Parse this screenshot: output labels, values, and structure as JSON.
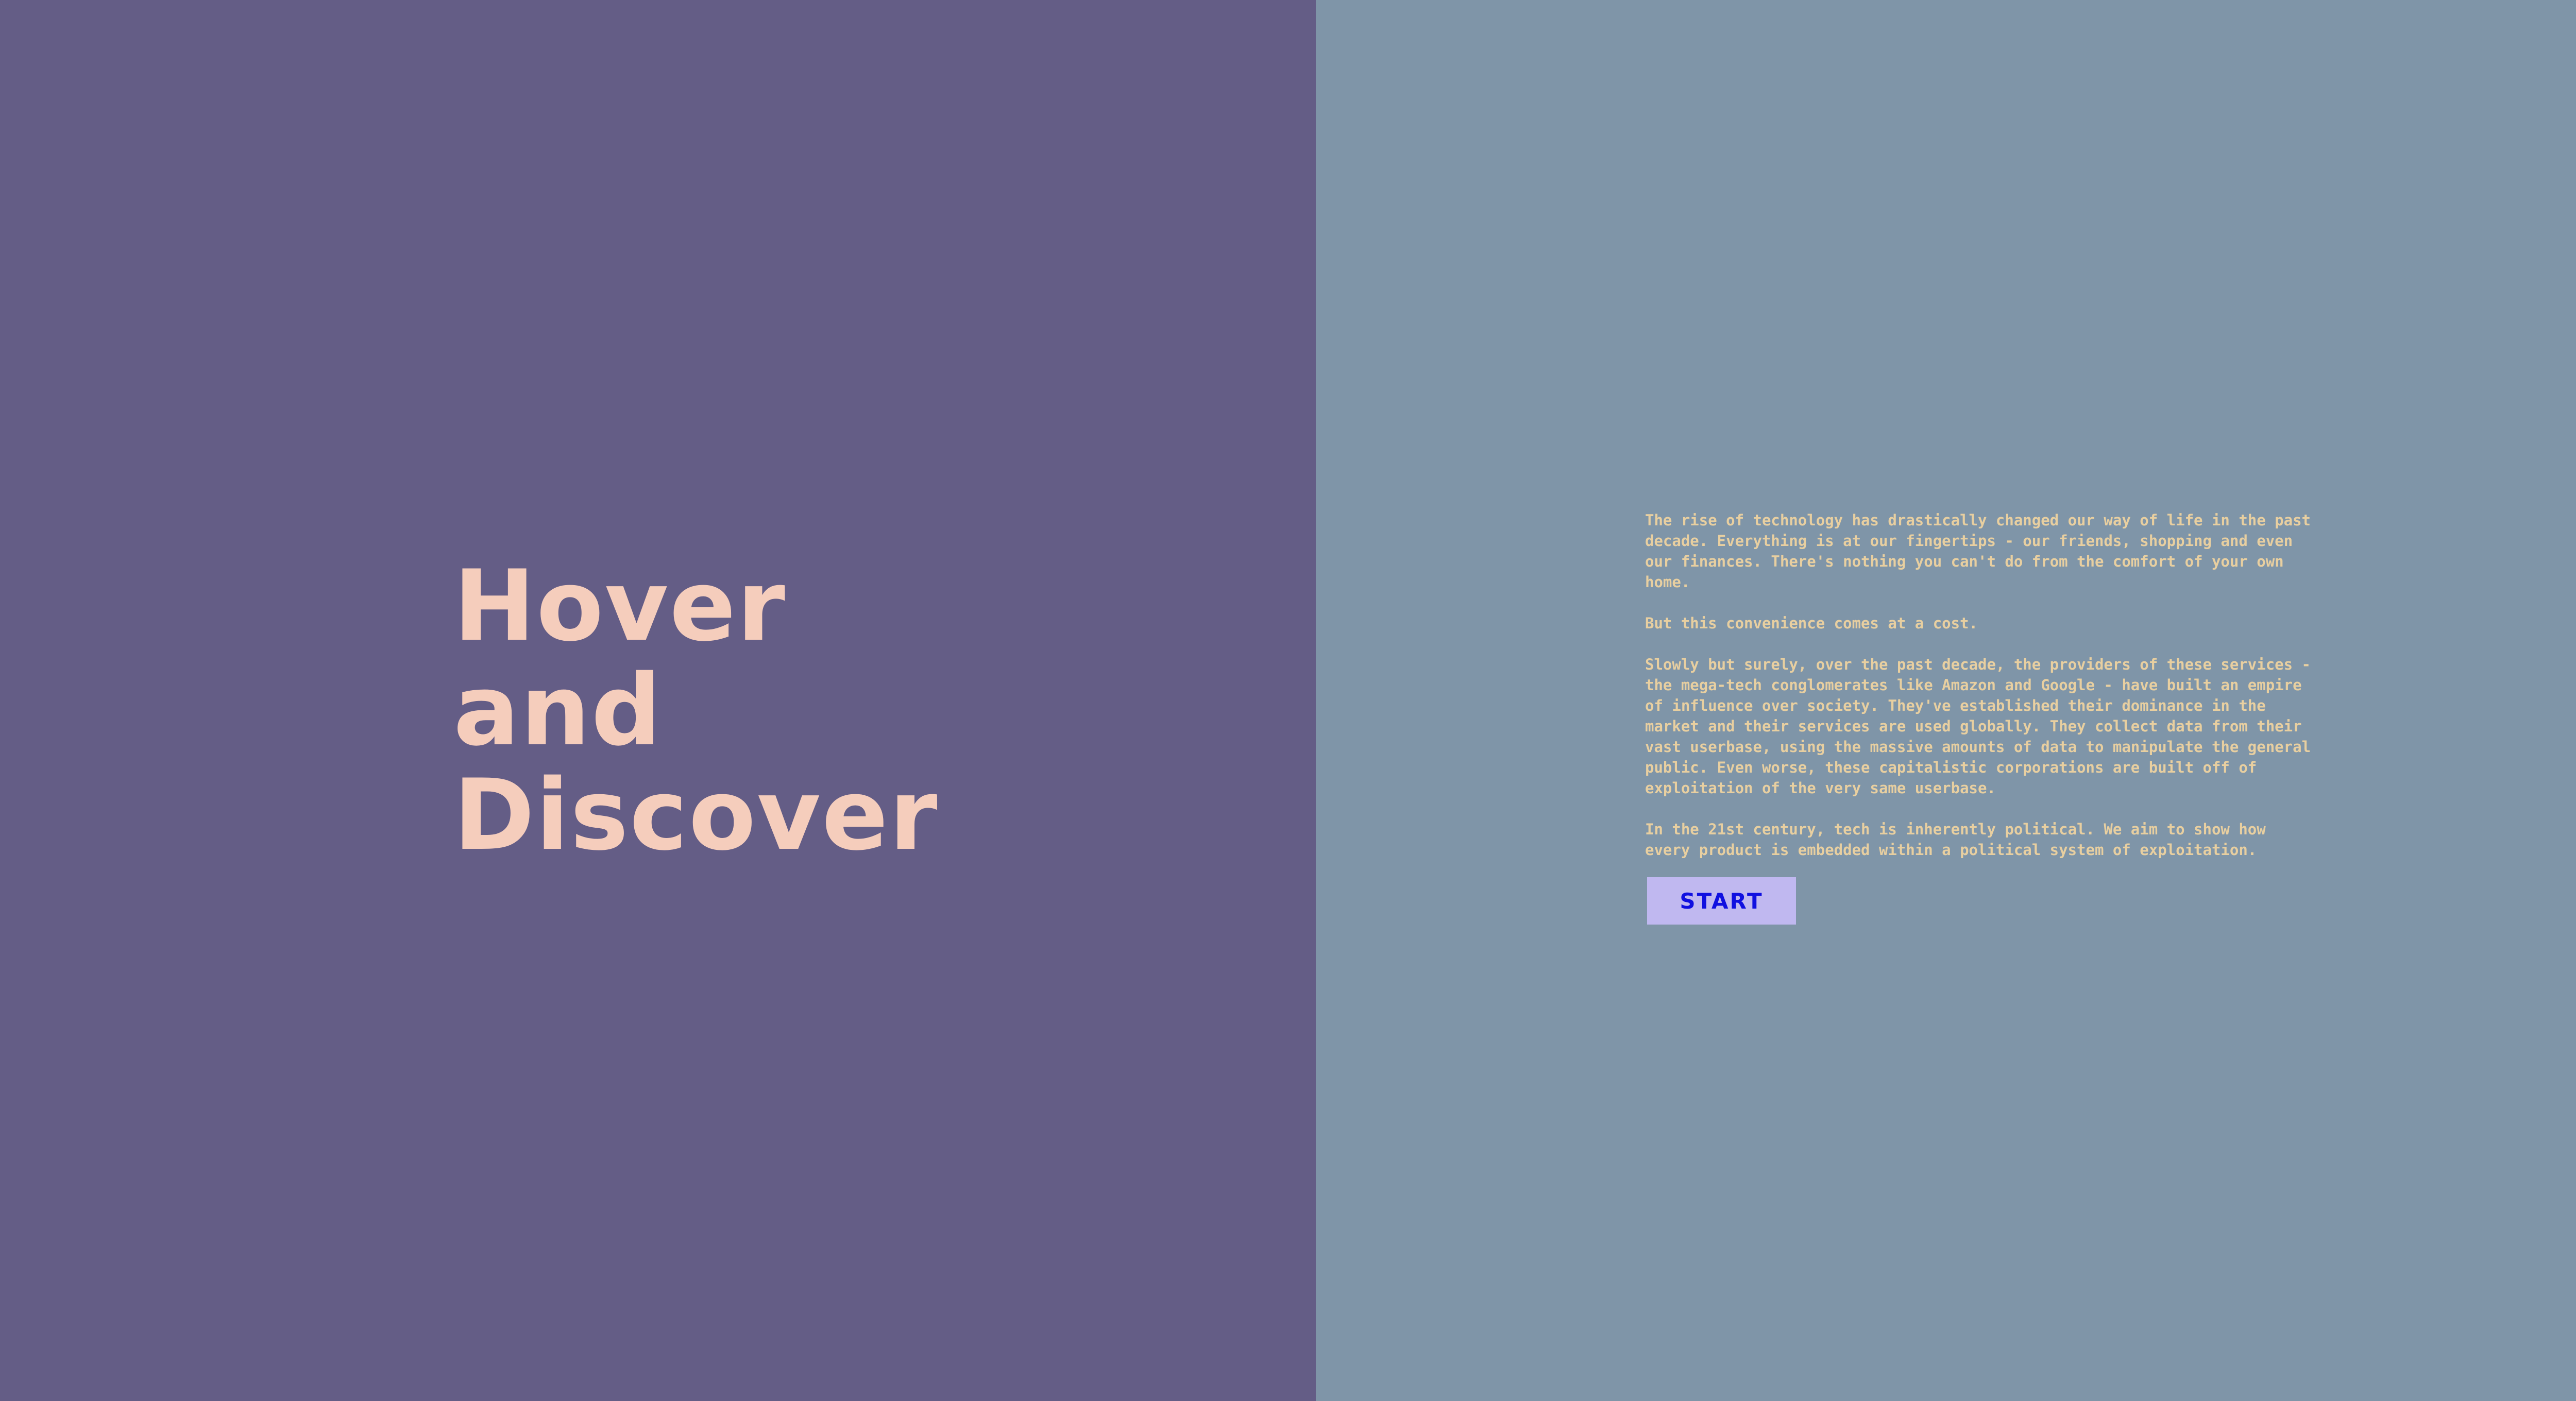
{
  "colors": {
    "left_bg": "#645D86",
    "right_bg": "#7F95A8",
    "title": "#F5CDBC",
    "body_text": "#E8CFA0",
    "button_bg": "#C0B8F0",
    "button_text": "#1010E0"
  },
  "hero": {
    "title_lines": [
      "Hover",
      "and",
      "Discover"
    ]
  },
  "intro": {
    "paragraphs": [
      "The rise of technology has drastically changed our way of life in the past decade. Everything is at our fingertips - our friends, shopping and even our finances. There's nothing you can't do from the comfort of your own home.",
      "But this convenience comes at a cost.",
      "Slowly but surely, over the past decade, the providers of these services - the mega-tech conglomerates like Amazon and Google - have built an empire of influence over society. They've established their dominance in the market and their services are used globally. They collect data from their vast userbase, using the massive amounts of data to manipulate the general public. Even worse, these capitalistic corporations are built off of exploitation of the very same userbase.",
      "In the 21st century, tech is inherently political. We aim to show how every product is embedded within a political system of exploitation."
    ],
    "start_label": "START"
  }
}
